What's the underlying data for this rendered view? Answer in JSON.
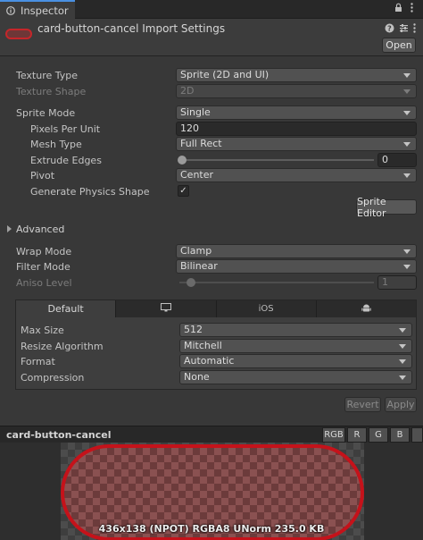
{
  "tab": {
    "icon": "info-icon",
    "label": "Inspector"
  },
  "tab_actions": {
    "lock_icon": "lock-icon",
    "menu_icon": "kebab-menu-icon"
  },
  "header": {
    "title": "card-button-cancel Import Settings",
    "help_icon": "help-icon",
    "settings_icon": "sliders-icon",
    "overflow_icon": "kebab-menu-icon",
    "open_label": "Open"
  },
  "fields": {
    "texture_type": {
      "label": "Texture Type",
      "value": "Sprite (2D and UI)"
    },
    "texture_shape": {
      "label": "Texture Shape",
      "value": "2D"
    },
    "sprite_mode": {
      "label": "Sprite Mode",
      "value": "Single"
    },
    "pixels_per_unit": {
      "label": "Pixels Per Unit",
      "value": "120"
    },
    "mesh_type": {
      "label": "Mesh Type",
      "value": "Full Rect"
    },
    "extrude_edges": {
      "label": "Extrude Edges",
      "value": "0",
      "slider_fraction": 0
    },
    "pivot": {
      "label": "Pivot",
      "value": "Center"
    },
    "generate_physics_shape": {
      "label": "Generate Physics Shape",
      "checked": true,
      "check_glyph": "✓"
    },
    "sprite_editor_label": "Sprite Editor"
  },
  "advanced": {
    "label": "Advanced",
    "expanded": false
  },
  "wrap_mode": {
    "label": "Wrap Mode",
    "value": "Clamp"
  },
  "filter_mode": {
    "label": "Filter Mode",
    "value": "Bilinear"
  },
  "aniso_level": {
    "label": "Aniso Level",
    "value": "1",
    "slider_fraction": 0
  },
  "platform_tabs": [
    {
      "label": "Default",
      "active": true
    },
    {
      "icon": "monitor-icon",
      "active": false
    },
    {
      "label": "iOS",
      "active": false
    },
    {
      "icon": "android-icon",
      "active": false
    }
  ],
  "platform_fields": {
    "max_size": {
      "label": "Max Size",
      "value": "512"
    },
    "resize_algorithm": {
      "label": "Resize Algorithm",
      "value": "Mitchell"
    },
    "format": {
      "label": "Format",
      "value": "Automatic"
    },
    "compression": {
      "label": "Compression",
      "value": "None"
    }
  },
  "actions": {
    "revert_label": "Revert",
    "apply_label": "Apply"
  },
  "preview": {
    "name": "card-button-cancel",
    "channels": [
      "RGB",
      "R",
      "G",
      "B"
    ],
    "info": "436x138 (NPOT)  RGBA8 UNorm  235.0 KB",
    "sprite_outline_color": "#c5121a"
  }
}
